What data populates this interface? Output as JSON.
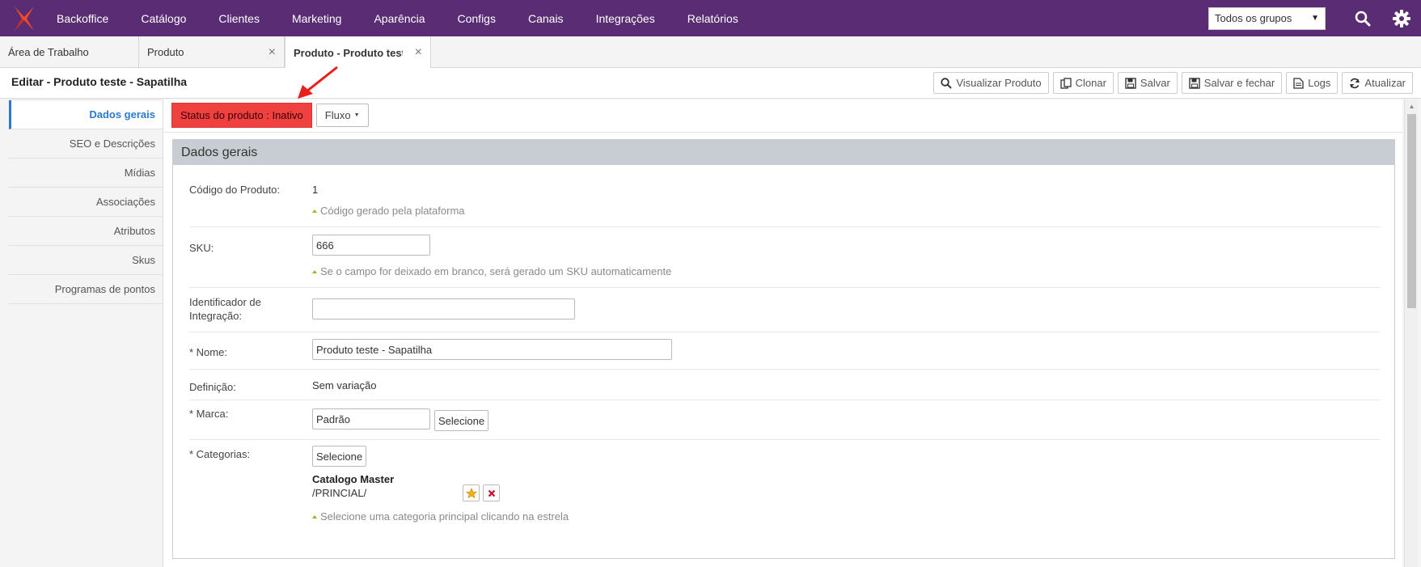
{
  "topnav": {
    "items": [
      "Backoffice",
      "Catálogo",
      "Clientes",
      "Marketing",
      "Aparência",
      "Configs",
      "Canais",
      "Integrações",
      "Relatórios"
    ],
    "group_select": "Todos os grupos",
    "brand_color": "#5a2c73"
  },
  "tabs": [
    {
      "label": "Área de Trabalho"
    },
    {
      "label": "Produto",
      "close": "×"
    },
    {
      "label": "Produto - Produto teste",
      "close": "×"
    }
  ],
  "header": {
    "title": "Editar - Produto teste - Sapatilha",
    "actions": {
      "view": "Visualizar Produto",
      "clone": "Clonar",
      "save": "Salvar",
      "save_close": "Salvar e fechar",
      "logs": "Logs",
      "refresh": "Atualizar"
    }
  },
  "sidebar": {
    "items": [
      {
        "label": "Dados gerais"
      },
      {
        "label": "SEO e Descrições"
      },
      {
        "label": "Mídias"
      },
      {
        "label": "Associações"
      },
      {
        "label": "Atributos"
      },
      {
        "label": "Skus"
      },
      {
        "label": "Programas de pontos"
      }
    ]
  },
  "status": {
    "label": "Status do produto : Inativo",
    "color": "#f04141",
    "flow_label": "Fluxo"
  },
  "form": {
    "section_title": "Dados gerais",
    "code": {
      "label": "Código do Produto:",
      "value": "1",
      "hint": "Código gerado pela plataforma"
    },
    "sku": {
      "label": "SKU:",
      "value": "666",
      "hint": "Se o campo for deixado em branco, será gerado um SKU automaticamente"
    },
    "integration_id": {
      "label_line1": "Identificador de",
      "label_line2": "Integração:",
      "value": ""
    },
    "name": {
      "label": "* Nome:",
      "value": "Produto teste - Sapatilha"
    },
    "definition": {
      "label": "Definição:",
      "value": "Sem variação"
    },
    "brand": {
      "label": "* Marca:",
      "value": "Padrão",
      "select_label": "Selecione"
    },
    "categories": {
      "label": "* Categorias:",
      "select_label": "Selecione",
      "catalog_name": "Catalogo Master",
      "path": "/PRINCIAL/",
      "hint": "Selecione uma categoria principal clicando na estrela"
    }
  }
}
